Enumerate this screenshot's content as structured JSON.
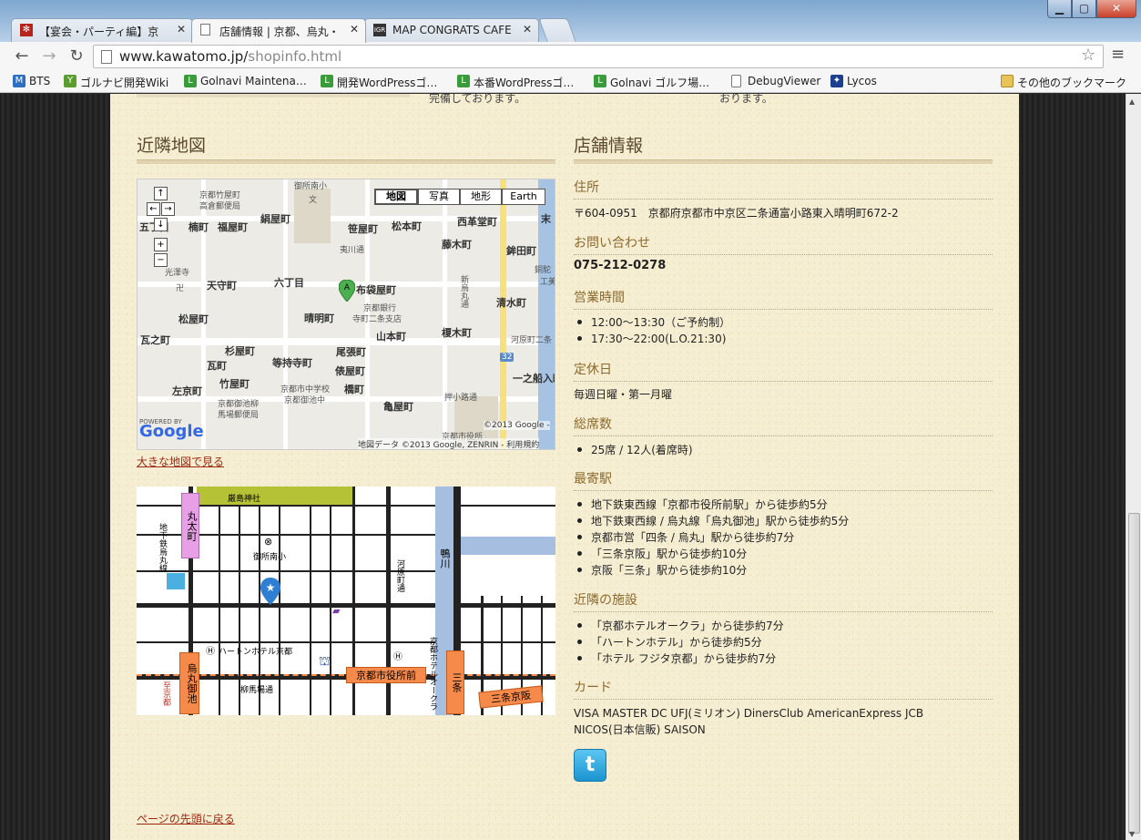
{
  "browser": {
    "tabs": [
      {
        "label": "【宴会・パーティ編】京"
      },
      {
        "label": "店舗情報 | 京都、烏丸・"
      },
      {
        "label": "MAP CONGRATS CAFE"
      }
    ],
    "url_host": "www.kawatomo.jp/",
    "url_path": "shopinfo.html",
    "bookmarks": [
      {
        "label": "BTS"
      },
      {
        "label": "ゴルナビ開発Wiki"
      },
      {
        "label": "Golnavi Maintena…"
      },
      {
        "label": "開発WordPressゴ…"
      },
      {
        "label": "本番WordPressゴ…"
      },
      {
        "label": "Golnavi ゴルフ場…"
      },
      {
        "label": "DebugViewer"
      },
      {
        "label": "Lycos"
      }
    ],
    "other_bookmarks": "その他のブックマーク"
  },
  "page": {
    "cut_text_left": "完備しております。",
    "cut_text_right": "おります。",
    "nearby_map_title": "近隣地図",
    "shop_info_title": "店舗情報",
    "map": {
      "types": [
        "地図",
        "写真",
        "地形",
        "Earth"
      ],
      "labels": [
        "京都竹屋町",
        "高倉郵便局",
        "御所南小",
        "文",
        "楠町",
        "福屋町",
        "絹屋町",
        "笹屋町",
        "松本町",
        "西革堂町",
        "末",
        "五丁目",
        "夷川通",
        "藤木町",
        "鉾田町",
        "光澤寺",
        "卍",
        "天守町",
        "六丁目",
        "布袋屋町",
        "京都銀行",
        "寺町二条支店",
        "銅駝",
        "工美",
        "松屋町",
        "晴明町",
        "清水町",
        "瓦之町",
        "杉屋町",
        "尾張町",
        "山本町",
        "榎木町",
        "河原町二条",
        "瓦町",
        "等持寺町",
        "俵屋町",
        "竹屋町",
        "橋町",
        "亀屋町",
        "押小路通",
        "一之船入町",
        "左京町",
        "京都市中学校",
        "京都御池中",
        "京都御池柳",
        "馬場郵便局",
        "京都市役所",
        "32",
        "新烏丸通",
        "御所南小"
      ],
      "copyright": "©2013 Google -",
      "attribution": "地図データ ©2013 Google, ZENRIN - 利用規約",
      "powered_by": "POWERED BY",
      "google": "Google"
    },
    "large_map_link": "大きな地図で見る",
    "access_map": {
      "shrine": "厳島神社",
      "marutamachi": "丸太町",
      "subway": "地下鉄烏丸線",
      "school": "御所南小",
      "kawaramachi": "河原町通",
      "kamogawa": "鴨川",
      "hotel_hearton": "ハートンホテル京都",
      "hotel_okura": "京都ホテルオークラ",
      "karasuma_oike": "烏丸御池",
      "city_hall": "京都市役所前",
      "sanjo": "三条",
      "sanjo_keihan": "三条京阪",
      "yanagi": "柳馬場通",
      "to_kyoto": "至京都"
    },
    "back_to_top": "ページの先頭に戻る"
  },
  "info": {
    "sections": [
      {
        "heading": "住所",
        "text": "〒604-0951　京都府京都市中京区二条通富小路東入晴明町672-2"
      },
      {
        "heading": "お問い合わせ",
        "text": "075-212-0278"
      },
      {
        "heading": "営業時間",
        "items": [
          "12:00〜13:30（ご予約制）",
          "17:30〜22:00(L.O.21:30)"
        ]
      },
      {
        "heading": "定休日",
        "text": "毎週日曜・第一月曜"
      },
      {
        "heading": "総席数",
        "items": [
          "25席 / 12人(着席時)"
        ]
      },
      {
        "heading": "最寄駅",
        "items": [
          "地下鉄東西線「京都市役所前駅」から徒歩約5分",
          "地下鉄東西線 / 烏丸線「烏丸御池」駅から徒歩約5分",
          "京都市営「四条 / 烏丸」駅から徒歩約7分",
          "「三条京阪」駅から徒歩約10分",
          "京阪「三条」駅から徒歩約10分"
        ]
      },
      {
        "heading": "近隣の施設",
        "items": [
          "「京都ホテルオークラ」から徒歩約7分",
          "「ハートンホテル」から徒歩約5分",
          "「ホテル フジタ京都」から徒歩約7分"
        ]
      },
      {
        "heading": "カード",
        "lines": [
          "VISA MASTER DC UFJ(ミリオン) DinersClub AmericanExpress JCB",
          "NICOS(日本信販) SAISON"
        ]
      }
    ],
    "twitter_icon": "twitter-icon"
  }
}
